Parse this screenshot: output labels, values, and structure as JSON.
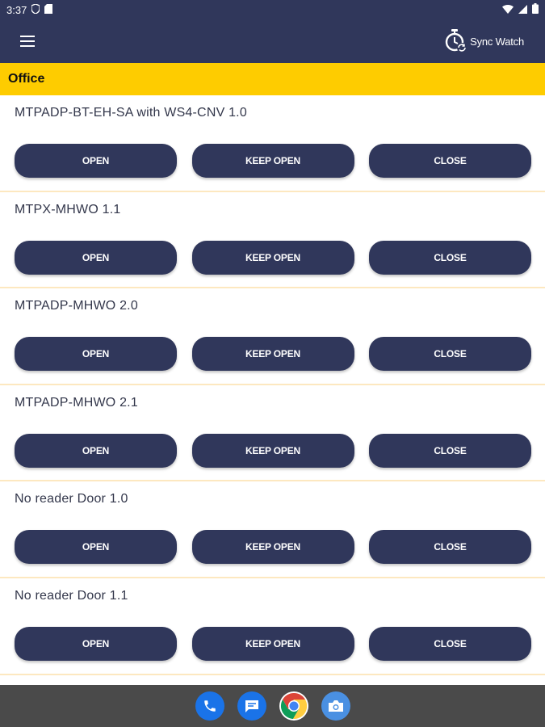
{
  "status_bar": {
    "time": "3:37",
    "icons": [
      "shield-icon",
      "sim-card-icon",
      "wifi-icon",
      "signal-icon",
      "battery-icon"
    ]
  },
  "app_bar": {
    "menu_icon": "hamburger-menu-icon",
    "sync_label": "Sync Watch",
    "sync_icon": "stopwatch-sync-icon"
  },
  "section": {
    "title": "Office"
  },
  "doors": [
    {
      "name": "MTPADP-BT-EH-SA with WS4-CNV 1.0",
      "open": "OPEN",
      "keep_open": "KEEP OPEN",
      "close": "CLOSE"
    },
    {
      "name": "MTPX-MHWO 1.1",
      "open": "OPEN",
      "keep_open": "KEEP OPEN",
      "close": "CLOSE"
    },
    {
      "name": "MTPADP-MHWO 2.0",
      "open": "OPEN",
      "keep_open": "KEEP OPEN",
      "close": "CLOSE"
    },
    {
      "name": "MTPADP-MHWO 2.1",
      "open": "OPEN",
      "keep_open": "KEEP OPEN",
      "close": "CLOSE"
    },
    {
      "name": "No reader Door 1.0",
      "open": "OPEN",
      "keep_open": "KEEP OPEN",
      "close": "CLOSE"
    },
    {
      "name": "No reader Door 1.1",
      "open": "OPEN",
      "keep_open": "KEEP OPEN",
      "close": "CLOSE"
    }
  ],
  "dock": {
    "apps": [
      "phone-icon",
      "messages-icon",
      "chrome-icon",
      "camera-icon"
    ]
  },
  "colors": {
    "primary": "#30375b",
    "accent": "#fecc00",
    "divider": "#fde8c0",
    "navbar": "#4a4a4a"
  }
}
